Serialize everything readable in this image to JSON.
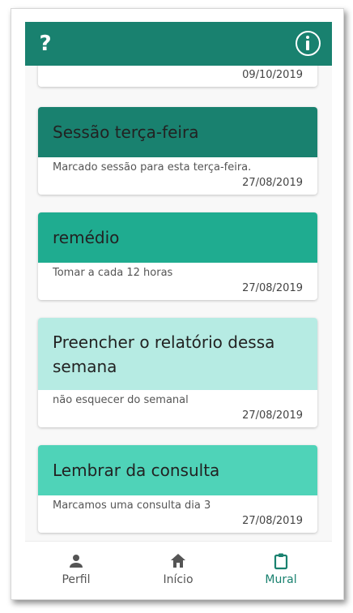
{
  "appbar": {
    "help_label": "?",
    "info_icon": "info-circle-icon"
  },
  "cards": [
    {
      "title": "",
      "description": "",
      "date": "09/10/2019"
    },
    {
      "title": "Sessão terça-feira",
      "description": "Marcado sessão para esta terça-feira.",
      "date": "27/08/2019",
      "color": "#19816f"
    },
    {
      "title": "remédio",
      "description": "Tomar a cada 12 horas",
      "date": "27/08/2019",
      "color": "#1fac90"
    },
    {
      "title": "Preencher o relatório dessa semana",
      "description": "não esquecer do semanal",
      "date": "27/08/2019",
      "color": "#b6ebe3"
    },
    {
      "title": "Lembrar da consulta",
      "description": "Marcamos uma consulta dia 3",
      "date": "27/08/2019",
      "color": "#4fd3b8"
    }
  ],
  "nav": {
    "items": [
      {
        "label": "Perfil",
        "icon": "person-icon"
      },
      {
        "label": "Início",
        "icon": "home-icon"
      },
      {
        "label": "Mural",
        "icon": "clipboard-icon",
        "active": true
      }
    ],
    "active_color": "#19816f"
  }
}
